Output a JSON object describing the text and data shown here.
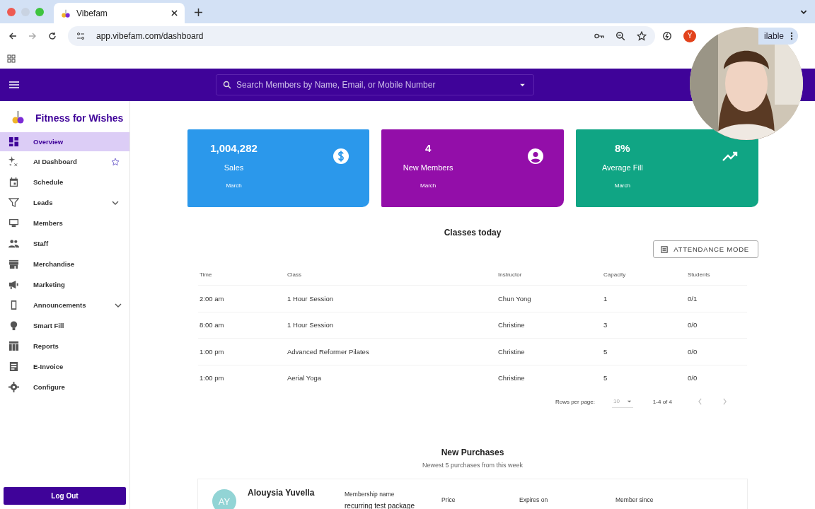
{
  "browser": {
    "tab_title": "Vibefam",
    "url": "app.vibefam.com/dashboard",
    "profile_initial": "Y",
    "profile_button": "ilable"
  },
  "search": {
    "placeholder": "Search Members by Name, Email, or Mobile Number"
  },
  "sidebar": {
    "brand": "Fitness for Wishes",
    "items": [
      {
        "label": "Overview",
        "selected": true,
        "kind": "plain"
      },
      {
        "label": "AI Dashboard",
        "selected": false,
        "kind": "starred"
      },
      {
        "label": "Schedule",
        "selected": false,
        "kind": "plain"
      },
      {
        "label": "Leads",
        "selected": false,
        "kind": "expandable"
      },
      {
        "label": "Members",
        "selected": false,
        "kind": "plain"
      },
      {
        "label": "Staff",
        "selected": false,
        "kind": "plain"
      },
      {
        "label": "Merchandise",
        "selected": false,
        "kind": "plain"
      },
      {
        "label": "Marketing",
        "selected": false,
        "kind": "plain"
      },
      {
        "label": "Announcements",
        "selected": false,
        "kind": "expandable"
      },
      {
        "label": "Smart Fill",
        "selected": false,
        "kind": "plain"
      },
      {
        "label": "Reports",
        "selected": false,
        "kind": "plain"
      },
      {
        "label": "E-Invoice",
        "selected": false,
        "kind": "plain"
      },
      {
        "label": "Configure",
        "selected": false,
        "kind": "plain"
      }
    ],
    "logout": "Log Out"
  },
  "stats": [
    {
      "value": "1,004,282",
      "label": "Sales",
      "period": "March",
      "color": "#2b98eb"
    },
    {
      "value": "4",
      "label": "New Members",
      "period": "March",
      "color": "#930ea9"
    },
    {
      "value": "8%",
      "label": "Average Fill",
      "period": "March",
      "color": "#10a584"
    }
  ],
  "classes": {
    "title": "Classes today",
    "button": "ATTENDANCE MODE",
    "columns": [
      "Time",
      "Class",
      "Instructor",
      "Capacity",
      "Students"
    ],
    "rows": [
      [
        "2:00 am",
        "1 Hour Session",
        "Chun Yong",
        "1",
        "0/1"
      ],
      [
        "8:00 am",
        "1 Hour Session",
        "Christine",
        "3",
        "0/0"
      ],
      [
        "1:00 pm",
        "Advanced Reformer Pilates",
        "Christine",
        "5",
        "0/0"
      ],
      [
        "1:00 pm",
        "Aerial Yoga",
        "Christine",
        "5",
        "0/0"
      ]
    ],
    "rows_per_page_label": "Rows per page:",
    "rows_per_page": "10",
    "range": "1-4 of 4"
  },
  "purchases": {
    "title": "New Purchases",
    "subtitle": "Newest 5 purchases from this week",
    "item": {
      "initials": "AY",
      "name": "Alouysia Yuvella",
      "membership_label": "Membership name",
      "membership": "recurring test package",
      "price_label": "Price",
      "expires_label": "Expires on",
      "since_label": "Member since"
    }
  }
}
